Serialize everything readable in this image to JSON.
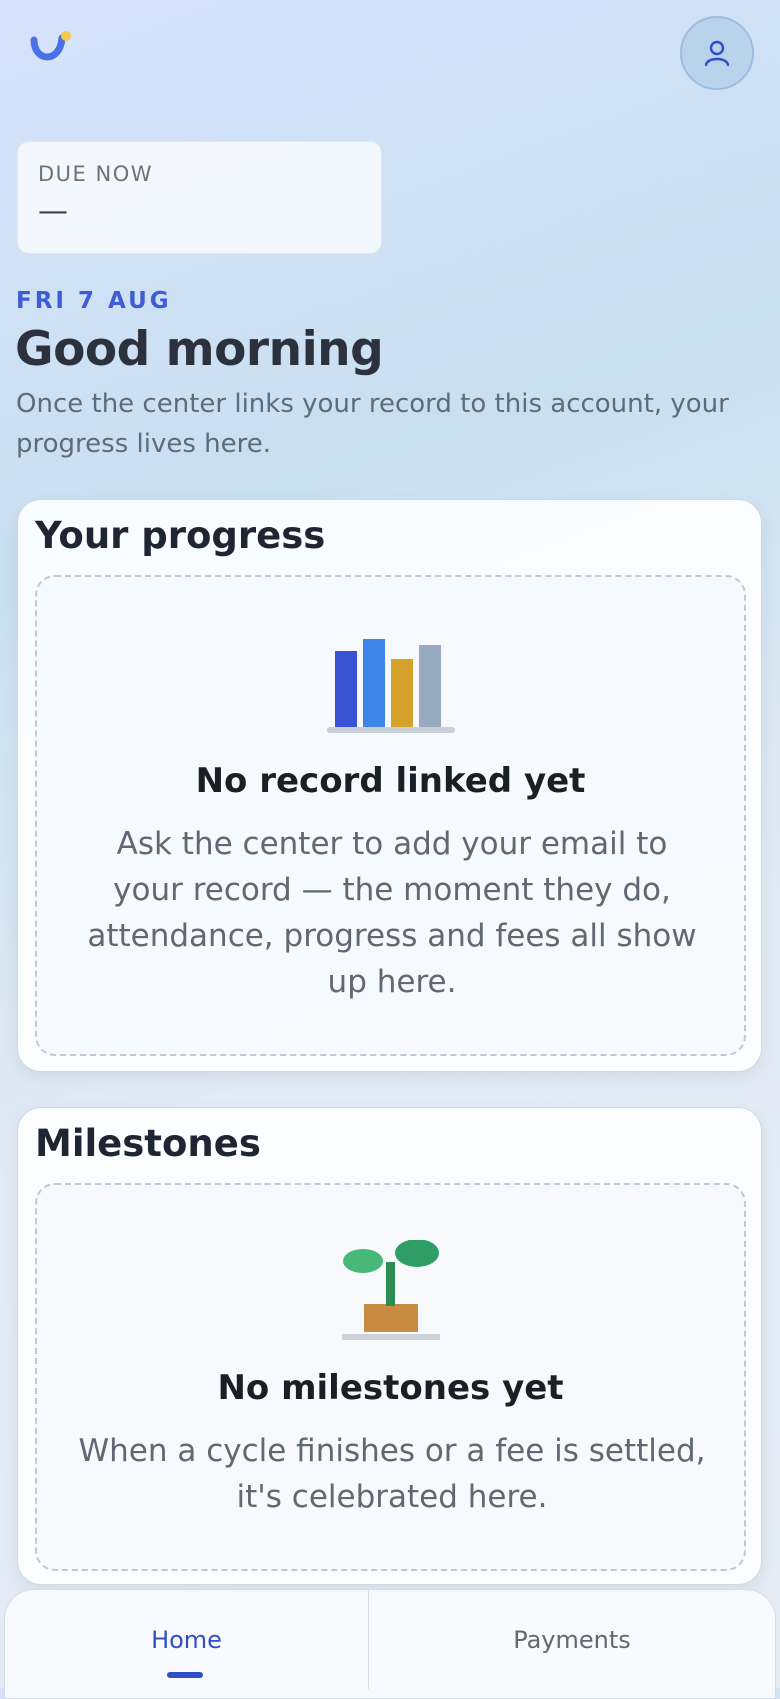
{
  "header": {
    "logo_icon": "app-logo-icon",
    "avatar_icon": "user-icon"
  },
  "due": {
    "label": "DUE NOW",
    "value": "—"
  },
  "greeting": {
    "date": "FRI 7 AUG",
    "title": "Good morning",
    "subtitle": "Once the center links your record to this account, your progress lives here."
  },
  "progress_card": {
    "title": "Your progress",
    "empty_icon": "bar-chart-icon",
    "empty_title": "No record linked yet",
    "empty_body": "Ask the center to add your email to your record — the moment they do, attendance, progress and fees all show up here."
  },
  "milestones_card": {
    "title": "Milestones",
    "empty_icon": "sprout-icon",
    "empty_title": "No milestones yet",
    "empty_body": "When a cycle finishes or a fee is settled, it's celebrated here."
  },
  "nav": {
    "items": [
      {
        "label": "Home",
        "active": true
      },
      {
        "label": "Payments",
        "active": false
      }
    ]
  },
  "colors": {
    "accent": "#2e4fc7",
    "date_blue": "#3f5bd6"
  }
}
